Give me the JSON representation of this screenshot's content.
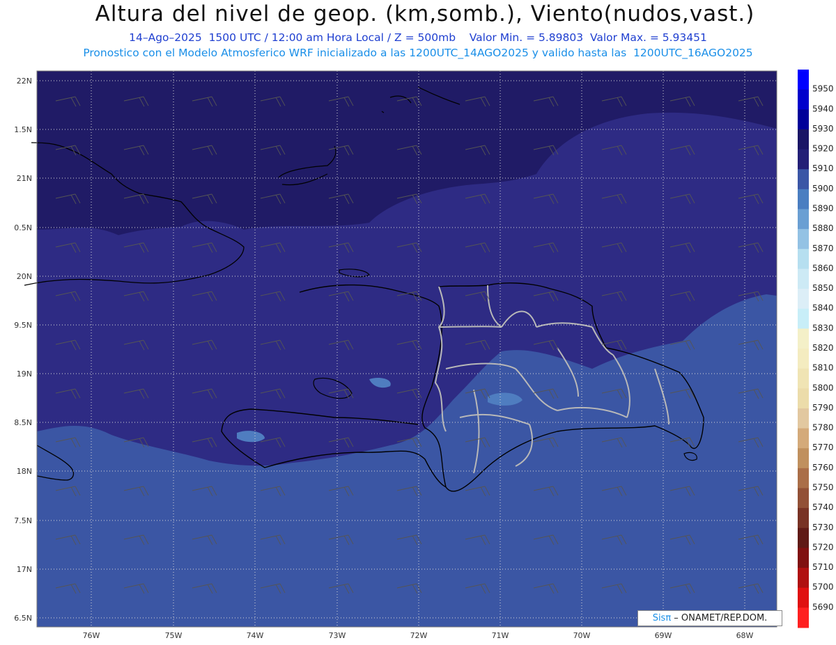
{
  "header": {
    "title": "Altura del nivel de geop. (km,somb.), Viento(nudos,vast.)",
    "subtitle_1": "14–Ago–2025  1500 UTC / 12:00 am Hora Local / Z = 500mb    Valor Min. = 5.89803  Valor Max. = 5.93451",
    "subtitle_2": "Pronostico con el Modelo Atmosferico WRF inicializado a las 1200UTC_14AGO2025 y valido hasta las  1200UTC_16AGO2025"
  },
  "axes": {
    "lat_labels": [
      "22N",
      "1.5N",
      "21N",
      "0.5N",
      "20N",
      "9.5N",
      "19N",
      "8.5N",
      "18N",
      "7.5N",
      "17N",
      "6.5N"
    ],
    "lon_labels": [
      "76W",
      "75W",
      "74W",
      "73W",
      "72W",
      "71W",
      "70W",
      "69W",
      "68W"
    ]
  },
  "colorbar": {
    "levels": [
      "5950",
      "5940",
      "5930",
      "5920",
      "5910",
      "5900",
      "5890",
      "5880",
      "5870",
      "5860",
      "5850",
      "5840",
      "5830",
      "5820",
      "5810",
      "5800",
      "5790",
      "5780",
      "5770",
      "5760",
      "5750",
      "5740",
      "5730",
      "5720",
      "5710",
      "5700",
      "5690"
    ],
    "colors": [
      "#0000ff",
      "#0000cc",
      "#000099",
      "#1a1566",
      "#231f77",
      "#3a56a6",
      "#4a7ec1",
      "#6a9fd3",
      "#93c2e4",
      "#b6dff0",
      "#cdeaf5",
      "#dceef7",
      "#c8eef8",
      "#f4f0c8",
      "#f4ecc0",
      "#f0e4b4",
      "#ecdcaa",
      "#e2c8a0",
      "#d4aa7a",
      "#c0905e",
      "#aa6e48",
      "#925036",
      "#783224",
      "#601a16",
      "#801010",
      "#b01010",
      "#e01010",
      "#ff2020"
    ]
  },
  "map_colors": {
    "level_5920": "#201b66",
    "level_5910": "#2e2b84",
    "level_5900": "#3b56a4",
    "level_5890": "#4f7dc0",
    "coast": "#000000",
    "provinces": "#b8b8b8"
  },
  "credit": {
    "logo": "Sisπ",
    "text": " – ONAMET/REP.DOM."
  }
}
